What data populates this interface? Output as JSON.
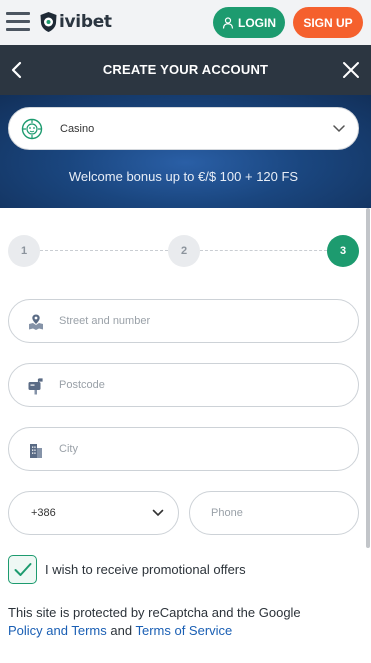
{
  "header": {
    "logo_text": "ivibet",
    "login_label": "LOGIN",
    "signup_label": "SIGN UP",
    "accent_green": "#1d9b6f",
    "accent_orange": "#f5602d"
  },
  "modal": {
    "title": "CREATE YOUR ACCOUNT"
  },
  "banner": {
    "product_select_value": "Casino",
    "bonus_text": "Welcome bonus up to €/$ 100 + 120 FS"
  },
  "steps": [
    {
      "label": "1"
    },
    {
      "label": "2"
    },
    {
      "label": "3",
      "active": true
    }
  ],
  "form": {
    "street_placeholder": "Street and number",
    "postcode_placeholder": "Postcode",
    "city_placeholder": "City",
    "phone_code": "+386",
    "phone_placeholder": "Phone",
    "promo_label": "I wish to receive promotional offers",
    "promo_checked": true
  },
  "footer": {
    "captcha_text": "This site is protected by reCaptcha and the Google",
    "policy_link": "Policy and Terms",
    "and_text": "and",
    "tos_link": "Terms of Service"
  }
}
